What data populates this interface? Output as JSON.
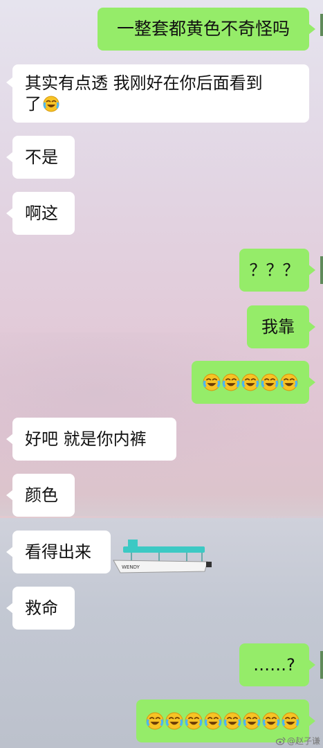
{
  "messages": [
    {
      "side": "right",
      "text": "一整套都黄色不奇怪吗"
    },
    {
      "side": "left",
      "text": "其实有点透  我刚好在你后面看到",
      "text2": "了",
      "emoji_after": "laugh-cry"
    },
    {
      "side": "left",
      "text": "不是"
    },
    {
      "side": "left",
      "text": "啊这"
    },
    {
      "side": "right",
      "text": "？？？"
    },
    {
      "side": "right",
      "text": "我靠"
    },
    {
      "side": "right",
      "emoji_count": 5,
      "emoji": "laugh-cry"
    },
    {
      "side": "left",
      "text": "好吧  就是你内裤"
    },
    {
      "side": "left",
      "text": "颜色"
    },
    {
      "side": "left",
      "text": "看得出来"
    },
    {
      "side": "left",
      "text": "救命"
    },
    {
      "side": "right",
      "text": "……?"
    },
    {
      "side": "right",
      "emoji_count": 8,
      "emoji": "laugh-cry"
    }
  ],
  "boat_label": "WENDY",
  "watermark": {
    "icon": "weibo-icon",
    "text": "@赵子谦"
  },
  "colors": {
    "bubble_green": "#95ec69",
    "bubble_white": "#ffffff"
  }
}
